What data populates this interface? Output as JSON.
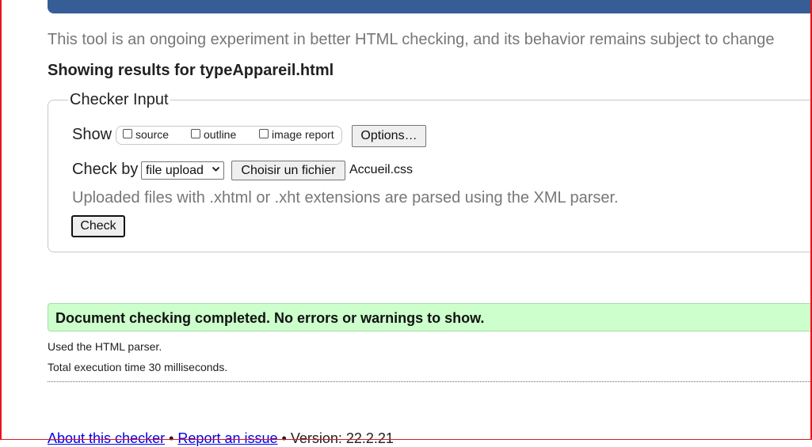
{
  "experiment_note": "This tool is an ongoing experiment in better HTML checking, and its behavior remains subject to change",
  "results_title": "Showing results for typeAppareil.html",
  "checker_input": {
    "legend": "Checker Input",
    "show_label": "Show",
    "show_options": [
      {
        "label": "source",
        "checked": false
      },
      {
        "label": "outline",
        "checked": false
      },
      {
        "label": "image report",
        "checked": false
      }
    ],
    "options_button": "Options…",
    "check_by_label": "Check by",
    "check_by_selected": "file upload",
    "file_button": "Choisir un fichier",
    "file_name": "Accueil.css",
    "parser_note": "Uploaded files with .xhtml or .xht extensions are parsed using the XML parser.",
    "check_button": "Check"
  },
  "result": {
    "success_message": "Document checking completed. No errors or warnings to show.",
    "parser_used": "Used the HTML parser.",
    "execution_time": "Total execution time 30 milliseconds."
  },
  "footer": {
    "about_link": "About this checker",
    "separator": "•",
    "report_link": "Report an issue",
    "version": "Version: 22.2.21"
  },
  "colors": {
    "top_bar": "#365d95",
    "success_bg": "#ccffcc",
    "frame": "#e8131b",
    "link": "#0000ee"
  }
}
